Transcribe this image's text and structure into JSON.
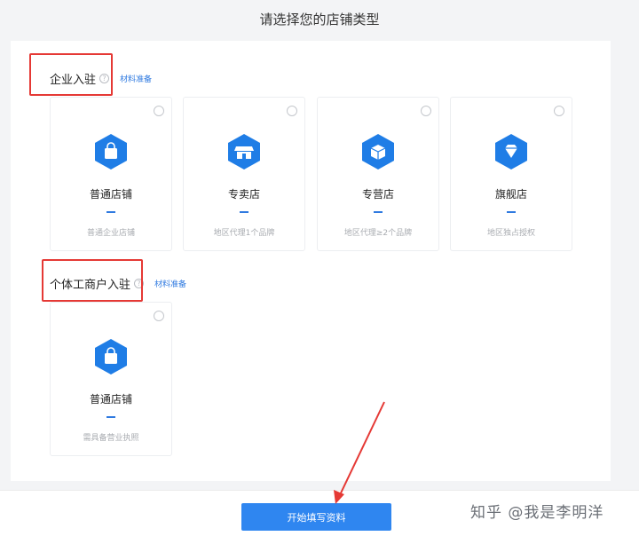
{
  "page_title": "请选择您的店铺类型",
  "colors": {
    "accent": "#2f7ae0",
    "hex_icon": "#1f7de6",
    "annotation_red": "#e53935"
  },
  "sections": [
    {
      "title": "企业入驻",
      "help_glyph": "?",
      "materials_label": "材料准备",
      "cards": [
        {
          "name": "普通店铺",
          "desc": "普通企业店铺",
          "icon": "shopping-bag-icon"
        },
        {
          "name": "专卖店",
          "desc": "地区代理1个品牌",
          "icon": "storefront-icon"
        },
        {
          "name": "专营店",
          "desc": "地区代理≥2个品牌",
          "icon": "box-icon"
        },
        {
          "name": "旗舰店",
          "desc": "地区独占授权",
          "icon": "diamond-icon"
        }
      ]
    },
    {
      "title": "个体工商户入驻",
      "help_glyph": "?",
      "materials_label": "材料准备",
      "cards": [
        {
          "name": "普通店铺",
          "desc": "需具备营业执照",
          "icon": "shopping-bag-icon"
        }
      ]
    }
  ],
  "start_button_label": "开始填写资料",
  "watermark": "知乎 @我是李明洋"
}
